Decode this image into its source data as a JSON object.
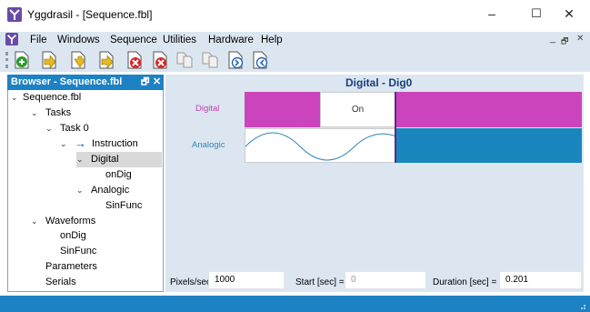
{
  "window": {
    "title": "Yggdrasil - [Sequence.fbl]",
    "minimize": "–",
    "maximize": "☐",
    "close": "✕"
  },
  "menu": {
    "items": [
      "File",
      "Windows",
      "Sequence",
      "Utilities",
      "Hardware",
      "Help"
    ],
    "mdi_min": "_",
    "mdi_restore": "🗗",
    "mdi_close": "✕"
  },
  "toolbar": {
    "buttons": [
      "add-icon",
      "yellow-arrow-1-icon",
      "yellow-arrow-2-icon",
      "yellow-arrow-3-icon",
      "red-delete-1-icon",
      "red-delete-2-icon",
      "gray-copy-icon",
      "gray-paste-icon",
      "document-forward-icon",
      "document-back-icon"
    ]
  },
  "browser": {
    "title": "Browser - Sequence.fbl",
    "pin": "🗗",
    "close": "✕",
    "tree": {
      "root": "Sequence.fbl",
      "tasks": "Tasks",
      "task0": "Task 0",
      "instruction": "Instruction",
      "digital": "Digital",
      "ondig": "onDig",
      "analogic": "Analogic",
      "sinfunc": "SinFunc",
      "waveforms": "Waveforms",
      "wf_ondig": "onDig",
      "wf_sinfunc": "SinFunc",
      "parameters": "Parameters",
      "serials": "Serials"
    }
  },
  "chart": {
    "title": "Digital - Dig0",
    "digital_label": "Digital",
    "analogic_label": "Analogic",
    "on_label": "On",
    "colors": {
      "digital": "#cc44bb",
      "analogic": "#1a86be"
    }
  },
  "bottom": {
    "pixels_label": "Pixels/sec",
    "pixels_value": "1000",
    "start_label": "Start [sec] =",
    "start_value": "0",
    "duration_label": "Duration [sec] =",
    "duration_value": "0.201"
  }
}
